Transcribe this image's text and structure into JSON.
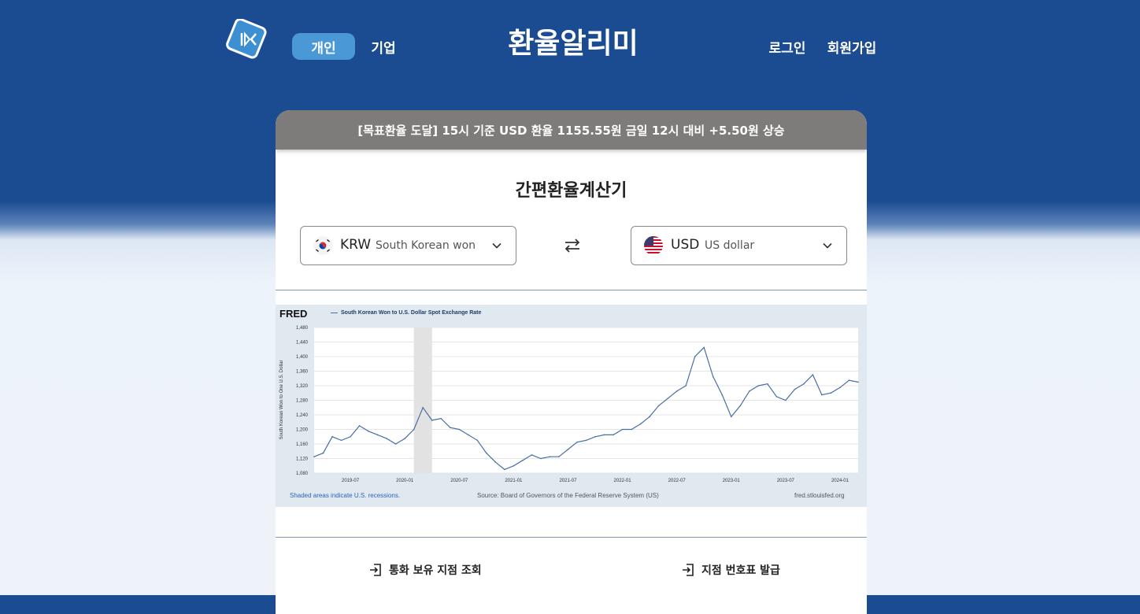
{
  "header": {
    "tabs": [
      {
        "label": "개인",
        "active": true
      },
      {
        "label": "기업",
        "active": false
      }
    ],
    "title": "환율알리미",
    "login_label": "로그인",
    "signup_label": "회원가입"
  },
  "banner": {
    "text": "[목표환율 도달]  15시 기준 USD 환율 1155.55원 금일 12시 대비 +5.50원 상승"
  },
  "calculator": {
    "title": "간편환율계산기",
    "from": {
      "code": "KRW",
      "name": "South Korean won",
      "flag_icon": "south-korea-flag-icon"
    },
    "to": {
      "code": "USD",
      "name": "US dollar",
      "flag_icon": "us-flag-icon"
    },
    "swap_icon": "swap-arrows-icon"
  },
  "chart": {
    "logo": "FRED",
    "legend": "South Korean Won to U.S. Dollar Spot Exchange Rate",
    "ylabel": "South Korean Won to One U.S. Dollar",
    "footnote_recession": "Shaded areas indicate U.S. recessions.",
    "source": "Source: Board of Governors of the Federal Reserve System (US)",
    "site": "fred.stlouisfed.org"
  },
  "chart_data": {
    "type": "line",
    "title": "South Korean Won to U.S. Dollar Spot Exchange Rate",
    "xlabel": "",
    "ylabel": "South Korean Won to One U.S. Dollar",
    "x_ticks": [
      "2019-07",
      "2020-01",
      "2020-07",
      "2021-01",
      "2021-07",
      "2022-01",
      "2022-07",
      "2023-01",
      "2023-07",
      "2024-01"
    ],
    "y_ticks": [
      1080,
      1120,
      1160,
      1200,
      1240,
      1280,
      1320,
      1360,
      1400,
      1440,
      1480
    ],
    "ylim": [
      1080,
      1480
    ],
    "xlim": [
      "2019-03",
      "2024-03"
    ],
    "grid": true,
    "recession": {
      "start": "2020-02",
      "end": "2020-04"
    },
    "series": [
      {
        "name": "South Korean Won to U.S. Dollar Spot Exchange Rate",
        "x": [
          "2019-03",
          "2019-04",
          "2019-05",
          "2019-06",
          "2019-07",
          "2019-08",
          "2019-09",
          "2019-10",
          "2019-11",
          "2019-12",
          "2020-01",
          "2020-02",
          "2020-03",
          "2020-04",
          "2020-05",
          "2020-06",
          "2020-07",
          "2020-08",
          "2020-09",
          "2020-10",
          "2020-11",
          "2020-12",
          "2021-01",
          "2021-02",
          "2021-03",
          "2021-04",
          "2021-05",
          "2021-06",
          "2021-07",
          "2021-08",
          "2021-09",
          "2021-10",
          "2021-11",
          "2021-12",
          "2022-01",
          "2022-02",
          "2022-03",
          "2022-04",
          "2022-05",
          "2022-06",
          "2022-07",
          "2022-08",
          "2022-09",
          "2022-10",
          "2022-11",
          "2022-12",
          "2023-01",
          "2023-02",
          "2023-03",
          "2023-04",
          "2023-05",
          "2023-06",
          "2023-07",
          "2023-08",
          "2023-09",
          "2023-10",
          "2023-11",
          "2023-12",
          "2024-01",
          "2024-02",
          "2024-03"
        ],
        "y": [
          1125,
          1135,
          1180,
          1170,
          1180,
          1210,
          1195,
          1185,
          1175,
          1160,
          1175,
          1200,
          1260,
          1225,
          1230,
          1205,
          1200,
          1185,
          1170,
          1135,
          1110,
          1090,
          1100,
          1115,
          1130,
          1120,
          1125,
          1125,
          1145,
          1165,
          1170,
          1180,
          1185,
          1185,
          1200,
          1200,
          1215,
          1235,
          1265,
          1285,
          1305,
          1320,
          1400,
          1425,
          1345,
          1295,
          1235,
          1265,
          1305,
          1320,
          1325,
          1290,
          1280,
          1310,
          1325,
          1350,
          1295,
          1300,
          1315,
          1335,
          1330
        ]
      }
    ]
  }
}
